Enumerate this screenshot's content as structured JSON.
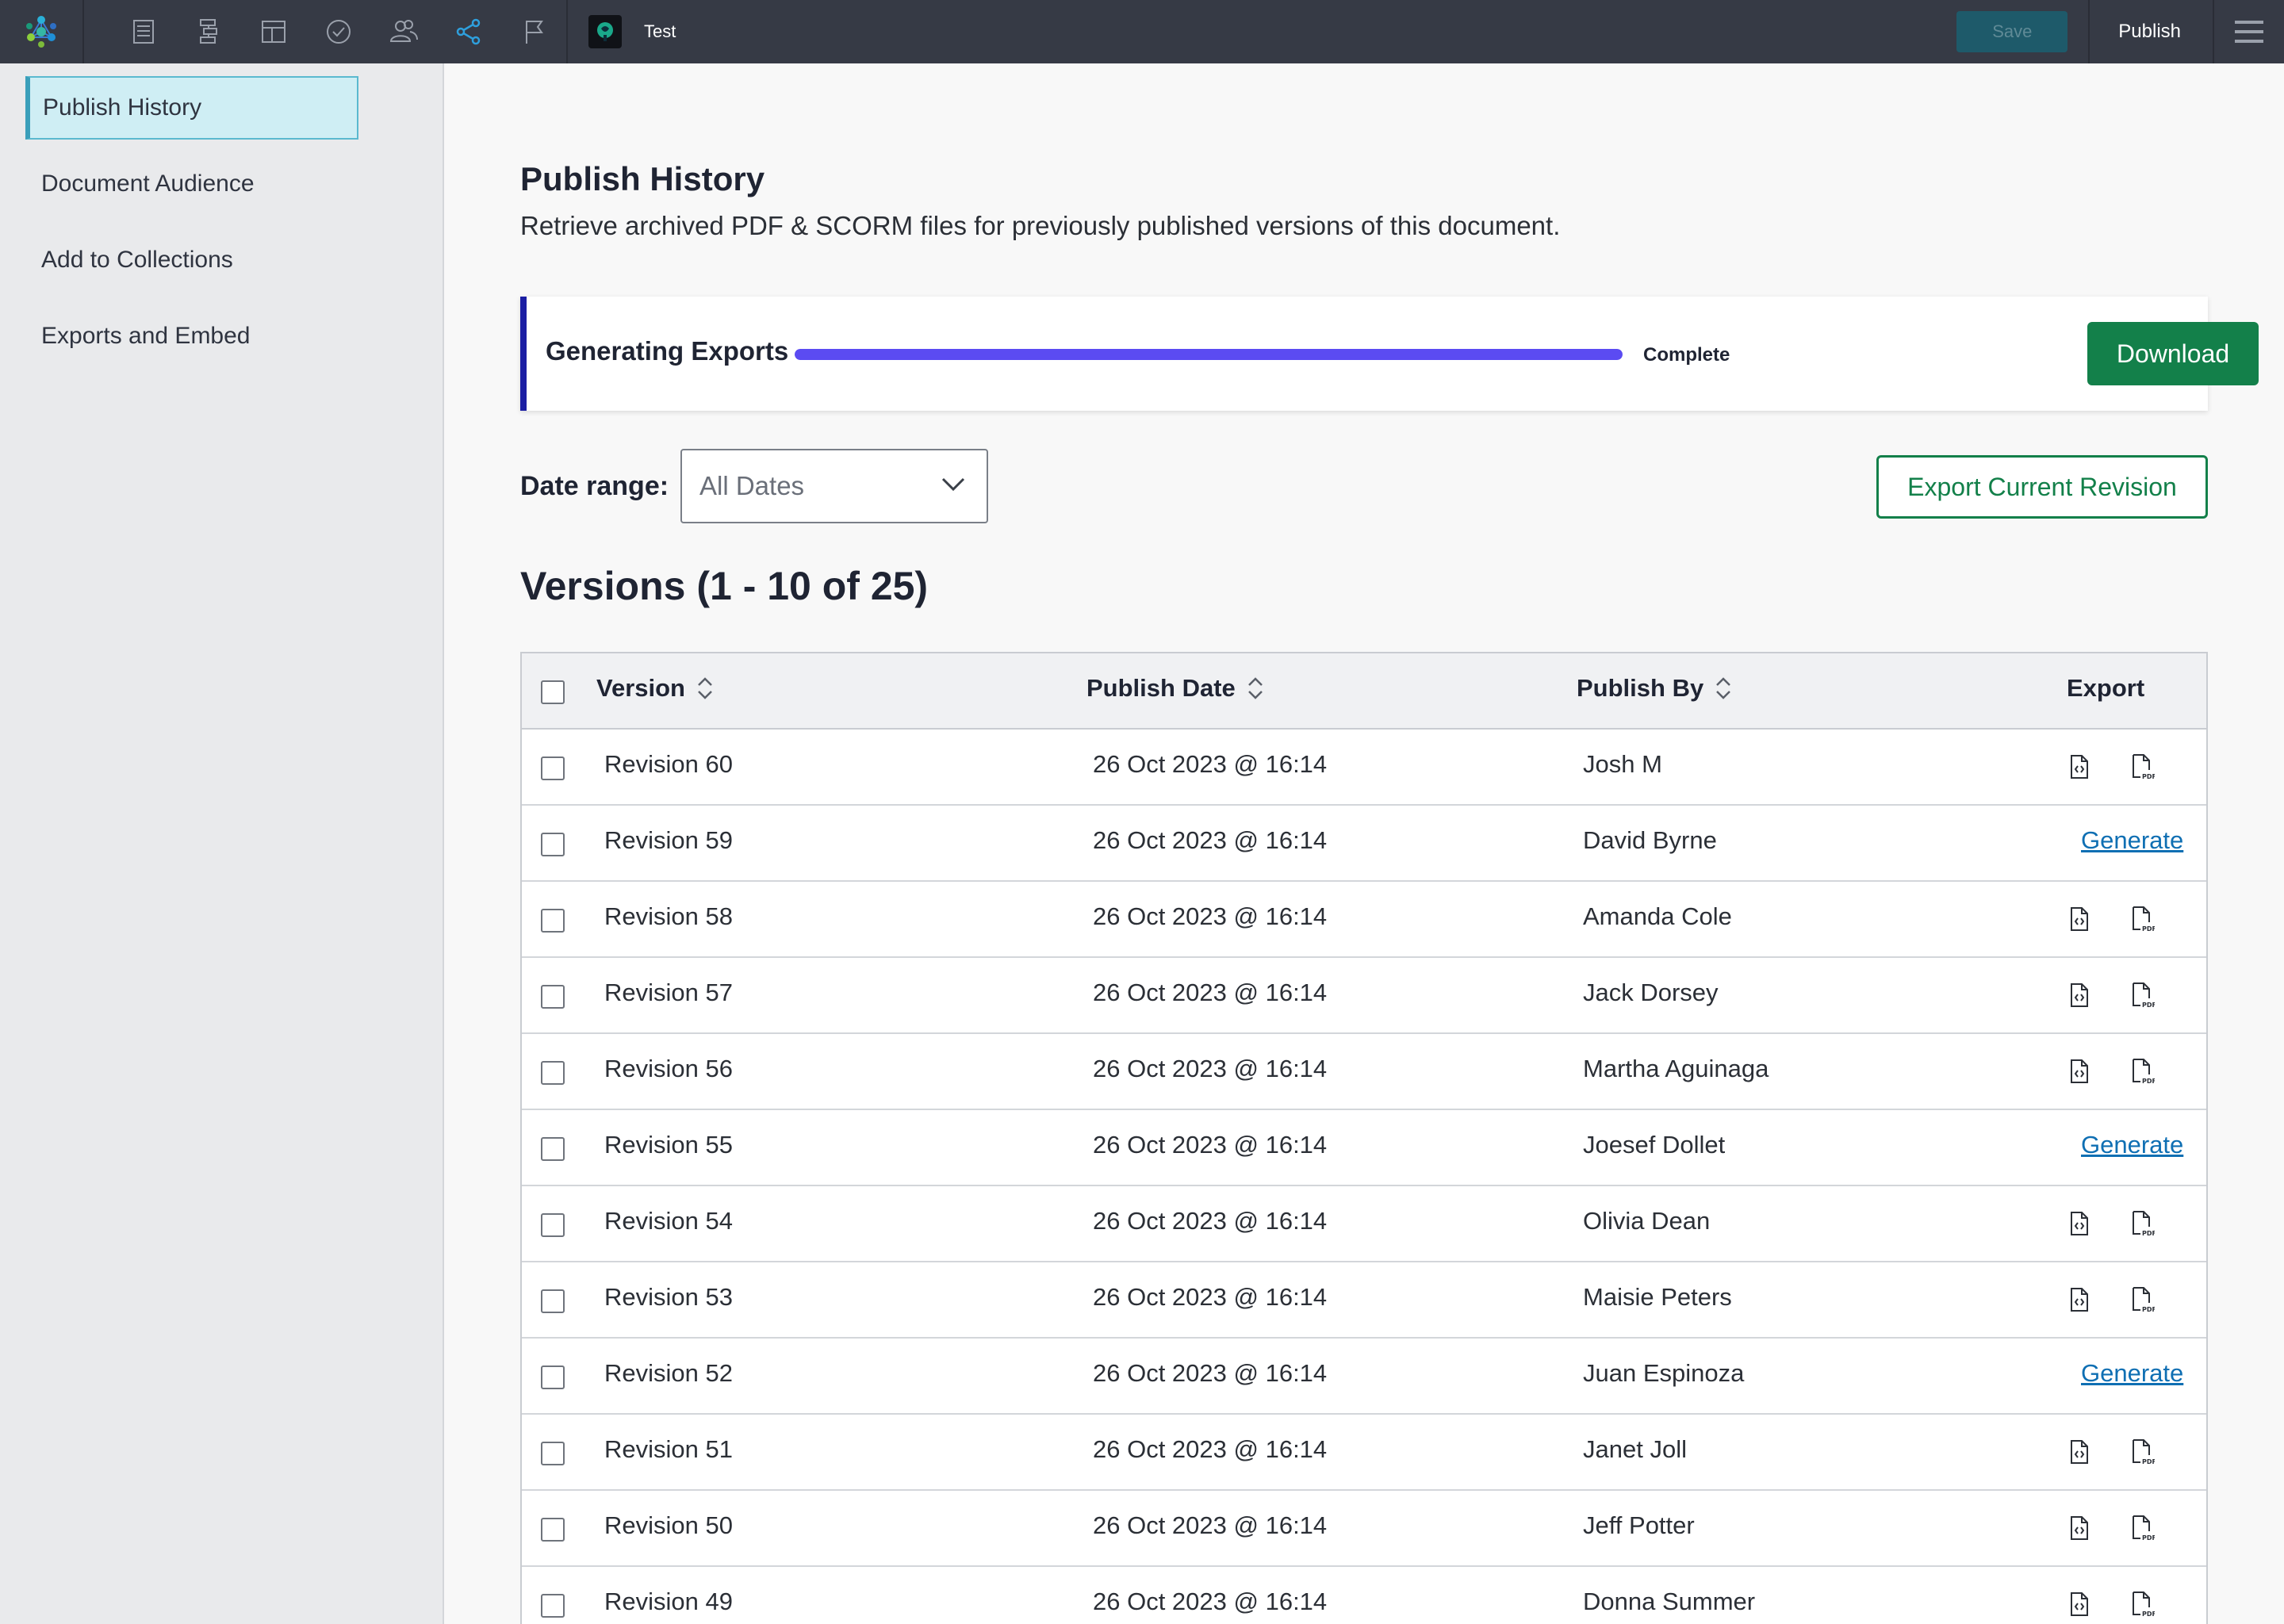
{
  "topbar": {
    "doc_title": "Test",
    "save_label": "Save",
    "publish_label": "Publish",
    "icons": [
      "app-logo-icon",
      "document-icon",
      "outline-icon",
      "layout-icon",
      "check-circle-icon",
      "users-icon",
      "share-icon",
      "flag-icon",
      "menu-icon"
    ],
    "active_icon": "share-icon",
    "accent_color": "#2e9fdc"
  },
  "sidebar": {
    "items": [
      {
        "label": "Publish History",
        "active": true
      },
      {
        "label": "Document Audience",
        "active": false
      },
      {
        "label": "Add to Collections",
        "active": false
      },
      {
        "label": "Exports and Embed",
        "active": false
      }
    ]
  },
  "main": {
    "title": "Publish History",
    "subtitle": "Retrieve archived PDF & SCORM files for previously published versions of this document.",
    "generating": {
      "label": "Generating Exports",
      "progress": 1.0,
      "status": "Complete",
      "download_label": "Download"
    },
    "date_range": {
      "label": "Date range:",
      "value": "All Dates"
    },
    "export_current_label": "Export Current Revision",
    "versions_title": "Versions (1 - 10 of 25)"
  },
  "table": {
    "columns": [
      "Version",
      "Publish Date",
      "Publish By",
      "Export"
    ],
    "generate_label": "Generate",
    "rows": [
      {
        "version": "Revision 60",
        "date": "26 Oct 2023 @ 16:14",
        "by": "Josh M",
        "export": "icons"
      },
      {
        "version": "Revision 59",
        "date": "26 Oct 2023 @ 16:14",
        "by": "David Byrne",
        "export": "generate"
      },
      {
        "version": "Revision 58",
        "date": "26 Oct 2023 @ 16:14",
        "by": "Amanda  Cole",
        "export": "icons"
      },
      {
        "version": "Revision 57",
        "date": "26 Oct 2023 @ 16:14",
        "by": "Jack  Dorsey",
        "export": "icons"
      },
      {
        "version": "Revision 56",
        "date": "26 Oct 2023 @ 16:14",
        "by": "Martha Aguinaga",
        "export": "icons"
      },
      {
        "version": "Revision 55",
        "date": "26 Oct 2023 @ 16:14",
        "by": "Joesef Dollet",
        "export": "generate"
      },
      {
        "version": "Revision 54",
        "date": "26 Oct 2023 @ 16:14",
        "by": "Olivia Dean",
        "export": "icons"
      },
      {
        "version": "Revision 53",
        "date": "26 Oct 2023 @ 16:14",
        "by": "Maisie Peters",
        "export": "icons"
      },
      {
        "version": "Revision 52",
        "date": "26 Oct 2023 @ 16:14",
        "by": "Juan Espinoza",
        "export": "generate"
      },
      {
        "version": "Revision 51",
        "date": "26 Oct 2023 @ 16:14",
        "by": "Janet Joll",
        "export": "icons"
      },
      {
        "version": "Revision 50",
        "date": "26 Oct 2023 @ 16:14",
        "by": "Jeff Potter",
        "export": "icons"
      },
      {
        "version": "Revision 49",
        "date": "26 Oct 2023 @ 16:14",
        "by": "Donna Summer",
        "export": "icons"
      }
    ]
  }
}
